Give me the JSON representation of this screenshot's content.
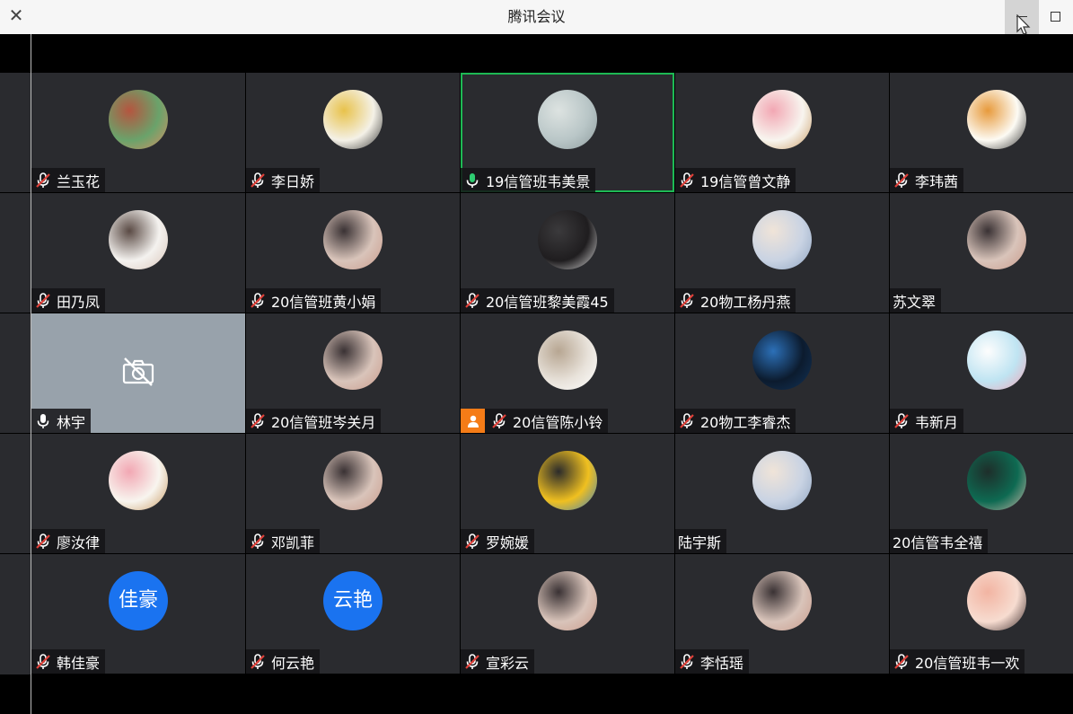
{
  "window": {
    "title": "腾讯会议"
  },
  "colors": {
    "tile_bg": "#2a2b2f",
    "active_border": "#1db954",
    "camera_off_bg": "#98a2ab",
    "text_avatar_bg": "#1a73f0",
    "host_badge": "#f57c17"
  },
  "participants": [
    {
      "name": "兰玉花",
      "mic": "muted",
      "avatar": "photo-bear"
    },
    {
      "name": "李日娇",
      "mic": "muted",
      "avatar": "photo-penguin"
    },
    {
      "name": "19信管班韦美景",
      "mic": "speaking",
      "avatar": "photo-cat",
      "active": true
    },
    {
      "name": "19信管曾文静",
      "mic": "muted",
      "avatar": "photo-cartoon"
    },
    {
      "name": "李玮茜",
      "mic": "muted",
      "avatar": "photo-tiger"
    },
    {
      "name": "田乃凤",
      "mic": "muted",
      "avatar": "photo-drawing"
    },
    {
      "name": "20信管班黄小娟",
      "mic": "muted",
      "avatar": "photo-person"
    },
    {
      "name": "20信管班黎美霞45",
      "mic": "muted",
      "avatar": "photo-dark"
    },
    {
      "name": "20物工杨丹燕",
      "mic": "muted",
      "avatar": "photo-anime"
    },
    {
      "name": "苏文翠",
      "mic": "none",
      "avatar": "photo-person"
    },
    {
      "name": "林宇",
      "mic": "on",
      "avatar": "camera-off"
    },
    {
      "name": "20信管班岑关月",
      "mic": "muted",
      "avatar": "photo-person"
    },
    {
      "name": "20信管陈小铃",
      "mic": "muted",
      "avatar": "photo-doll",
      "host": true
    },
    {
      "name": "20物工李睿杰",
      "mic": "muted",
      "avatar": "photo-blue"
    },
    {
      "name": "韦新月",
      "mic": "muted",
      "avatar": "photo-panda"
    },
    {
      "name": "廖汝律",
      "mic": "muted",
      "avatar": "photo-cartoon"
    },
    {
      "name": "邓凯菲",
      "mic": "muted",
      "avatar": "photo-person"
    },
    {
      "name": "罗婉媛",
      "mic": "muted",
      "avatar": "photo-yellow"
    },
    {
      "name": "陆宇斯",
      "mic": "none",
      "avatar": "photo-anime"
    },
    {
      "name": "20信管韦全禧",
      "mic": "none",
      "avatar": "photo-green"
    },
    {
      "name": "韩佳豪",
      "mic": "muted",
      "avatar": "text",
      "avatar_text": "佳豪"
    },
    {
      "name": "何云艳",
      "mic": "muted",
      "avatar": "text",
      "avatar_text": "云艳"
    },
    {
      "name": "宣彩云",
      "mic": "muted",
      "avatar": "photo-person"
    },
    {
      "name": "李恬瑶",
      "mic": "muted",
      "avatar": "photo-person"
    },
    {
      "name": "20信管班韦一欢",
      "mic": "muted",
      "avatar": "photo-baby"
    }
  ]
}
